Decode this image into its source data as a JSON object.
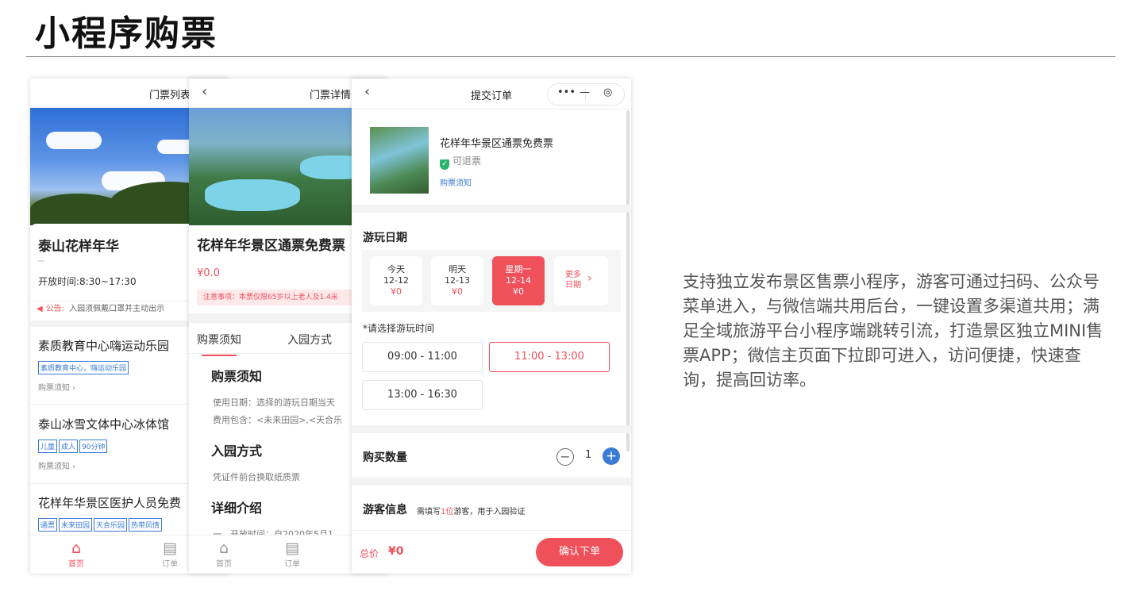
{
  "slide": {
    "title": "小程序购票",
    "description": "支持独立发布景区售票小程序，游客可通过扫码、公众号菜单进入，与微信端共用后台，一键设置多渠道共用；满足全域旅游平台小程序端跳转引流，打造景区独立MINI售票APP；微信主页面下拉即可进入，访问便捷，快速查询，提高回访率。"
  },
  "list_page": {
    "header_title": "门票列表",
    "scenic_name": "泰山花样年华",
    "open_hours": "开放时间:8:30~17:30",
    "notice_label": "公告:",
    "notice_text": "入园须佩戴口罩并主动出示",
    "tickets": [
      {
        "name": "素质教育中心嗨运动乐园",
        "tags": [
          "素质教育中心，嗨运动乐园"
        ],
        "link": "购票须知 ›"
      },
      {
        "name": "泰山冰雪文体中心冰体馆",
        "tags": [
          "儿童",
          "成人",
          "90分钟"
        ],
        "link": "购票须知 ›"
      },
      {
        "name": "花样年华景区医护人员免费",
        "tags": [
          "通票",
          "未来田园",
          "天合乐园",
          "热带风情"
        ]
      }
    ],
    "tabbar": [
      {
        "label": "首页",
        "icon": "home-icon"
      },
      {
        "label": "订单",
        "icon": "order-icon"
      }
    ]
  },
  "detail_page": {
    "header_title": "门票详情",
    "ticket_name": "花样年华景区通票免费票",
    "price": "¥0.0",
    "alert": "注意事项：本票仅限65岁以上老人及1.4米",
    "tabs": [
      "购票须知",
      "入园方式"
    ],
    "sections": [
      {
        "heading": "购票须知",
        "lines": [
          "使用日期：选择的游玩日期当天",
          "费用包含：<未来田园>,<天合乐"
        ]
      },
      {
        "heading": "入园方式",
        "lines": [
          "凭证件前台换取纸质票"
        ]
      },
      {
        "heading": "详细介绍",
        "lines": [
          "一、开放时间：自2020年5月1"
        ]
      }
    ],
    "tabbar": [
      {
        "label": "首页",
        "icon": "home-icon"
      },
      {
        "label": "订单",
        "icon": "order-icon"
      }
    ]
  },
  "order_page": {
    "header_title": "提交订单",
    "capsule": {
      "more": "•••",
      "minimize": "—",
      "close": "◎"
    },
    "product_name": "花样年华景区通票免费票",
    "refundable": "可退票",
    "notice_link": "购票须知",
    "date_section_title": "游玩日期",
    "dates": [
      {
        "label": "今天",
        "date": "12-12",
        "price": "¥0",
        "selected": false
      },
      {
        "label": "明天",
        "date": "12-13",
        "price": "¥0",
        "selected": false
      },
      {
        "label": "星期一",
        "date": "12-14",
        "price": "¥0",
        "selected": true
      }
    ],
    "more_dates": [
      "更多",
      "日期"
    ],
    "time_prompt": "*请选择游玩时间",
    "time_slots": [
      {
        "label": "09:00 - 11:00",
        "selected": false
      },
      {
        "label": "11:00 - 13:00",
        "selected": true
      },
      {
        "label": "13:00 - 16:30",
        "selected": false
      }
    ],
    "quantity_label": "购买数量",
    "quantity": "1",
    "visitor_title": "游客信息",
    "visitor_sub_prefix": "需填写",
    "visitor_sub_count": "1位",
    "visitor_sub_suffix": "游客，用于入园验证",
    "total_label": "总价",
    "total_value": "¥0",
    "confirm_label": "确认下单"
  },
  "colors": {
    "accent": "#f0505a",
    "link": "#3a7bd5",
    "success": "#2db36b"
  }
}
